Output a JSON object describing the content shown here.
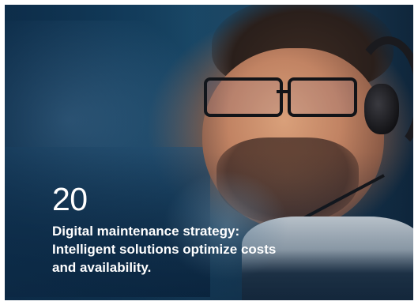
{
  "teaser_card": {
    "issue_number": "20",
    "headline_lines": [
      "Digital maintenance strategy:",
      "Intelligent solutions optimize costs",
      "and availability."
    ],
    "text_color": "#ffffff",
    "accent_background": "#14405f"
  }
}
